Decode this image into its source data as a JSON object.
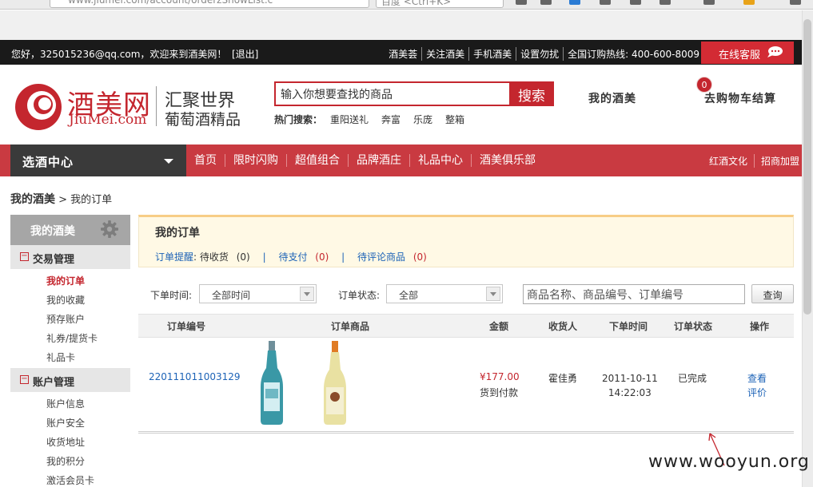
{
  "browser": {
    "address": "www.jiumei.com/account/orderzShowList.c",
    "search_placeholder": "百度 <Ctrl+K>"
  },
  "topbar": {
    "welcome": "您好，325015236@qq.com，欢迎来到酒美网！",
    "logout": "[退出]",
    "links": [
      "酒美荟",
      "关注酒美",
      "手机酒美",
      "设置勿扰",
      "全国订购热线: 400-600-8009"
    ],
    "service": "在线客服"
  },
  "header": {
    "logo_cn": "酒美网",
    "logo_en": "JiuMei.com",
    "slogan_line1": "汇聚世界",
    "slogan_line2": "葡萄酒精品",
    "search_placeholder": "输入你想要查找的商品",
    "search_button": "搜索",
    "hot_label": "热门搜索：",
    "hot_items": [
      "重阳送礼",
      "奔富",
      "乐庞",
      "整箱"
    ],
    "my_jiumei": "我的酒美",
    "cart_count": "0",
    "cart_label": "去购物车结算"
  },
  "nav": {
    "category": "选酒中心",
    "items": [
      "首页",
      "限时闪购",
      "超值组合",
      "品牌酒庄",
      "礼品中心",
      "酒美俱乐部"
    ],
    "right": [
      "红酒文化",
      "招商加盟"
    ]
  },
  "breadcrumb": {
    "root": "我的酒美",
    "sep": " > ",
    "current": "我的订单"
  },
  "sidebar": {
    "title": "我的酒美",
    "sections": [
      {
        "title": "交易管理",
        "items": [
          "我的订单",
          "我的收藏",
          "预存账户",
          "礼券/提货卡",
          "礼品卡"
        ]
      },
      {
        "title": "账户管理",
        "items": [
          "账户信息",
          "账户安全",
          "收货地址",
          "我的积分",
          "激活会员卡"
        ]
      }
    ]
  },
  "main": {
    "title": "我的订单",
    "remind_label": "订单提醒",
    "remind_colon": ":",
    "remind_receive": "待收货",
    "remind_receive_count": "(0)",
    "remind_pay": "待支付",
    "remind_pay_count": "(0)",
    "remind_review": "待评论商品",
    "remind_review_count": "(0)",
    "filter_time_label": "下单时间:",
    "filter_time_value": "全部时间",
    "filter_status_label": "订单状态:",
    "filter_status_value": "全部",
    "keyword_placeholder": "商品名称、商品编号、订单编号",
    "query_button": "查询",
    "columns": [
      "订单编号",
      "订单商品",
      "金额",
      "收货人",
      "下单时间",
      "订单状态",
      "操作"
    ],
    "order": {
      "id": "220111011003129",
      "price": "¥177.00",
      "payment": "货到付款",
      "receiver": "霍佳勇",
      "date": "2011-10-11",
      "time": "14:22:03",
      "status": "已完成",
      "op_view": "查看",
      "op_review": "评价"
    }
  },
  "watermark": "www.wooyun.org",
  "colors": {
    "brand_red": "#c4262e",
    "link_blue": "#1d63b7",
    "nav_red": "#c93a41"
  }
}
